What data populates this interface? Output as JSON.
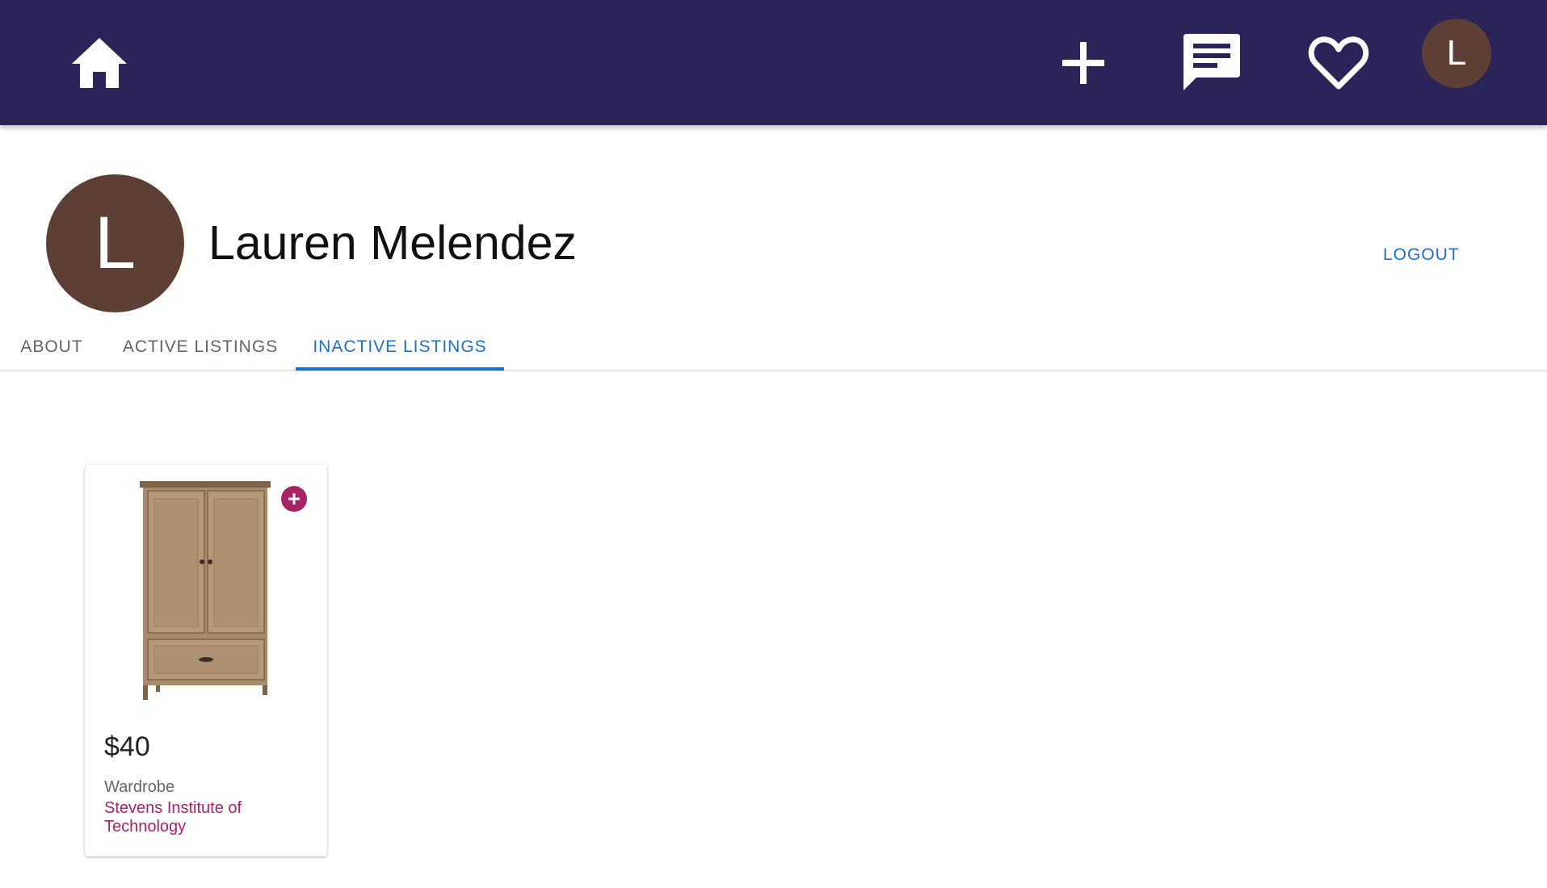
{
  "appbar": {
    "background": "#2b2459",
    "home_icon": "home-icon",
    "add_icon": "plus-icon",
    "messages_icon": "chat-icon",
    "favorites_icon": "heart-outline-icon",
    "avatar_initial": "L",
    "avatar_color": "#5d3f36"
  },
  "profile": {
    "avatar_initial": "L",
    "name": "Lauren Melendez",
    "logout_label": "LOGOUT"
  },
  "tabs": [
    {
      "label": "ABOUT",
      "active": false
    },
    {
      "label": "ACTIVE LISTINGS",
      "active": false
    },
    {
      "label": "INACTIVE LISTINGS",
      "active": true
    }
  ],
  "accent_color": "#1f6fc4",
  "listings": [
    {
      "image": "wardrobe-image",
      "add_icon": "add-circle-icon",
      "price": "$40",
      "title": "Wardrobe",
      "school": "Stevens Institute of Technology",
      "school_color": "#a62364"
    }
  ]
}
